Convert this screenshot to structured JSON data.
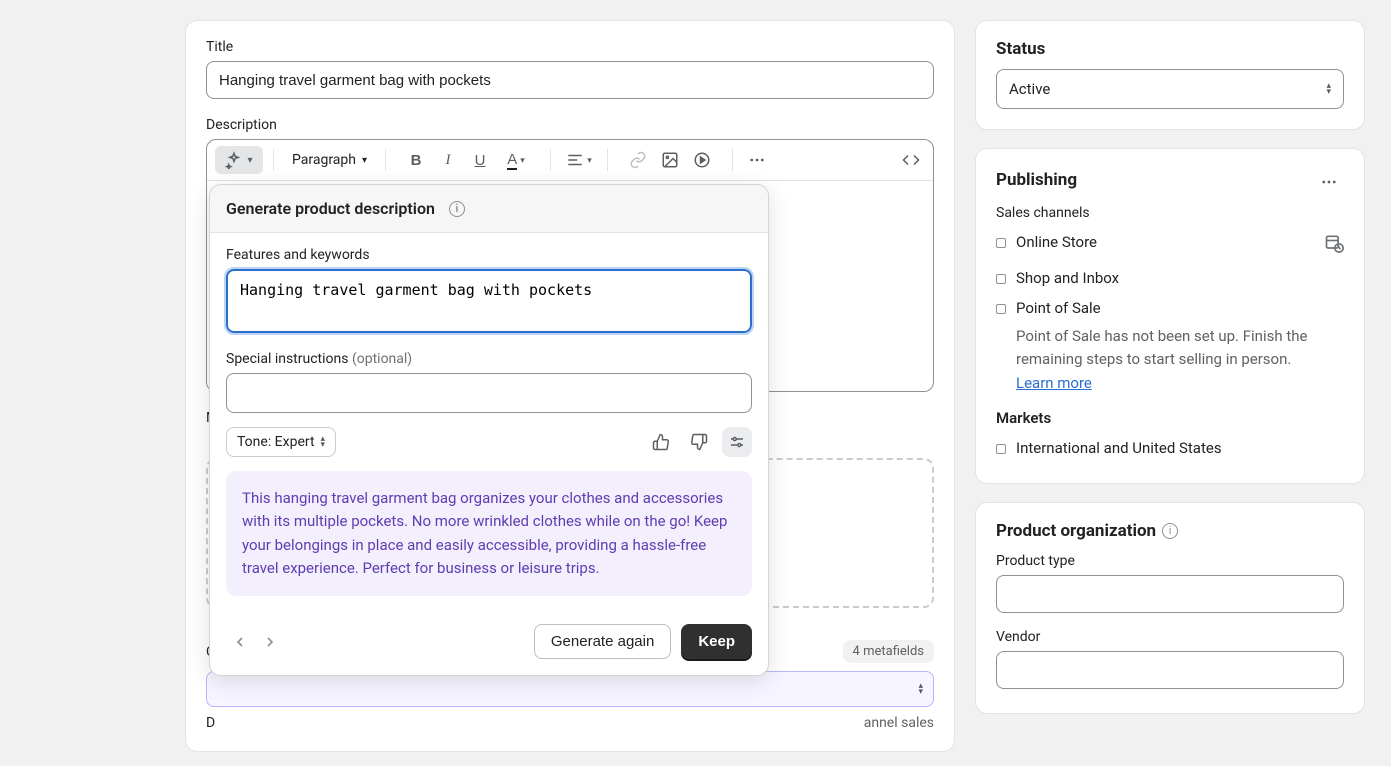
{
  "main": {
    "title_label": "Title",
    "title_value": "Hanging travel garment bag with pockets",
    "description_label": "Description",
    "media_initial": "M",
    "category_initial": "C",
    "determines_initial": "D",
    "channel_sales_fragment": "annel sales",
    "metafields_badge": "4 metafields"
  },
  "toolbar": {
    "paragraph_label": "Paragraph"
  },
  "ai": {
    "header": "Generate product description",
    "features_label": "Features and keywords",
    "features_value": "Hanging travel garment bag with pockets",
    "special_label": "Special instructions ",
    "special_optional": "(optional)",
    "tone_label": "Tone: Expert",
    "generated_text": "This hanging travel garment bag organizes your clothes and accessories with its multiple pockets. No more wrinkled clothes while on the go! Keep your belongings in place and easily accessible, providing a hassle-free travel experience. Perfect for business or leisure trips.",
    "generate_again": "Generate again",
    "keep": "Keep"
  },
  "status": {
    "heading": "Status",
    "value": "Active"
  },
  "publishing": {
    "heading": "Publishing",
    "sales_channels_label": "Sales channels",
    "channels": [
      {
        "name": "Online Store"
      },
      {
        "name": "Shop and Inbox"
      },
      {
        "name": "Point of Sale"
      }
    ],
    "pos_message": "Point of Sale has not been set up. Finish the remaining steps to start selling in person.",
    "learn_more": "Learn more",
    "markets_label": "Markets",
    "markets_value": "International and United States"
  },
  "organization": {
    "heading": "Product organization",
    "product_type_label": "Product type",
    "vendor_label": "Vendor"
  }
}
